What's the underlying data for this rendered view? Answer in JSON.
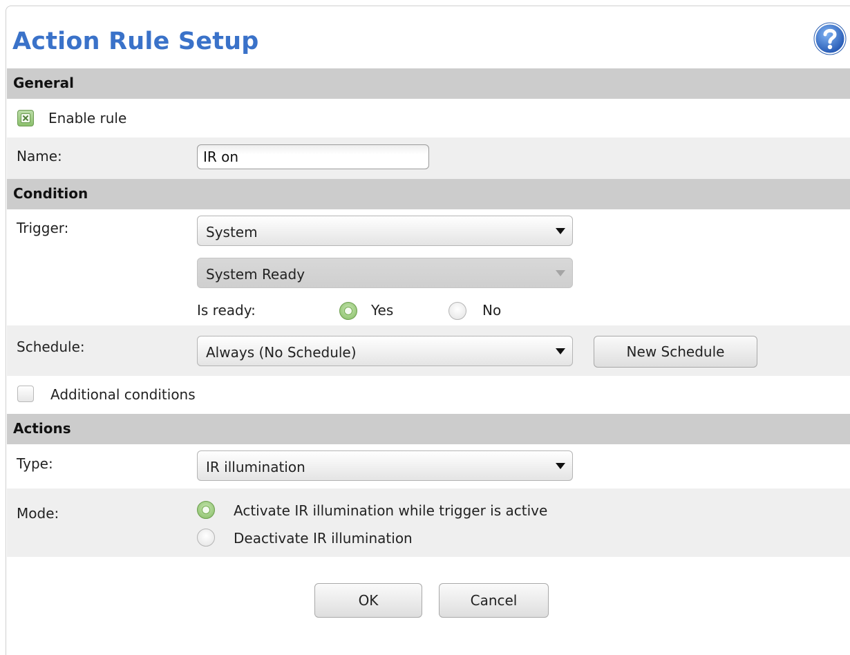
{
  "dialog": {
    "title": "Action Rule Setup",
    "help_icon": "help-question-icon"
  },
  "general": {
    "header": "General",
    "enable_rule": {
      "label": "Enable rule",
      "checked": true
    },
    "name": {
      "label": "Name:",
      "value": "IR on"
    }
  },
  "condition": {
    "header": "Condition",
    "trigger": {
      "label": "Trigger:",
      "value": "System",
      "sub_value": "System Ready"
    },
    "is_ready": {
      "label": "Is ready:",
      "options": [
        "Yes",
        "No"
      ],
      "selected": "Yes"
    },
    "schedule": {
      "label": "Schedule:",
      "value": "Always (No Schedule)",
      "new_button": "New Schedule"
    },
    "additional_conditions": {
      "label": "Additional conditions",
      "checked": false
    }
  },
  "actions": {
    "header": "Actions",
    "type": {
      "label": "Type:",
      "value": "IR illumination"
    },
    "mode": {
      "label": "Mode:",
      "options": [
        "Activate IR illumination while trigger is active",
        "Deactivate IR illumination"
      ],
      "selected": "Activate IR illumination while trigger is active"
    }
  },
  "footer": {
    "ok": "OK",
    "cancel": "Cancel"
  },
  "colors": {
    "title": "#3a72c9",
    "section_header": "#cccccc",
    "row_gray": "#efefef",
    "radio_checked": "#84bb62"
  }
}
